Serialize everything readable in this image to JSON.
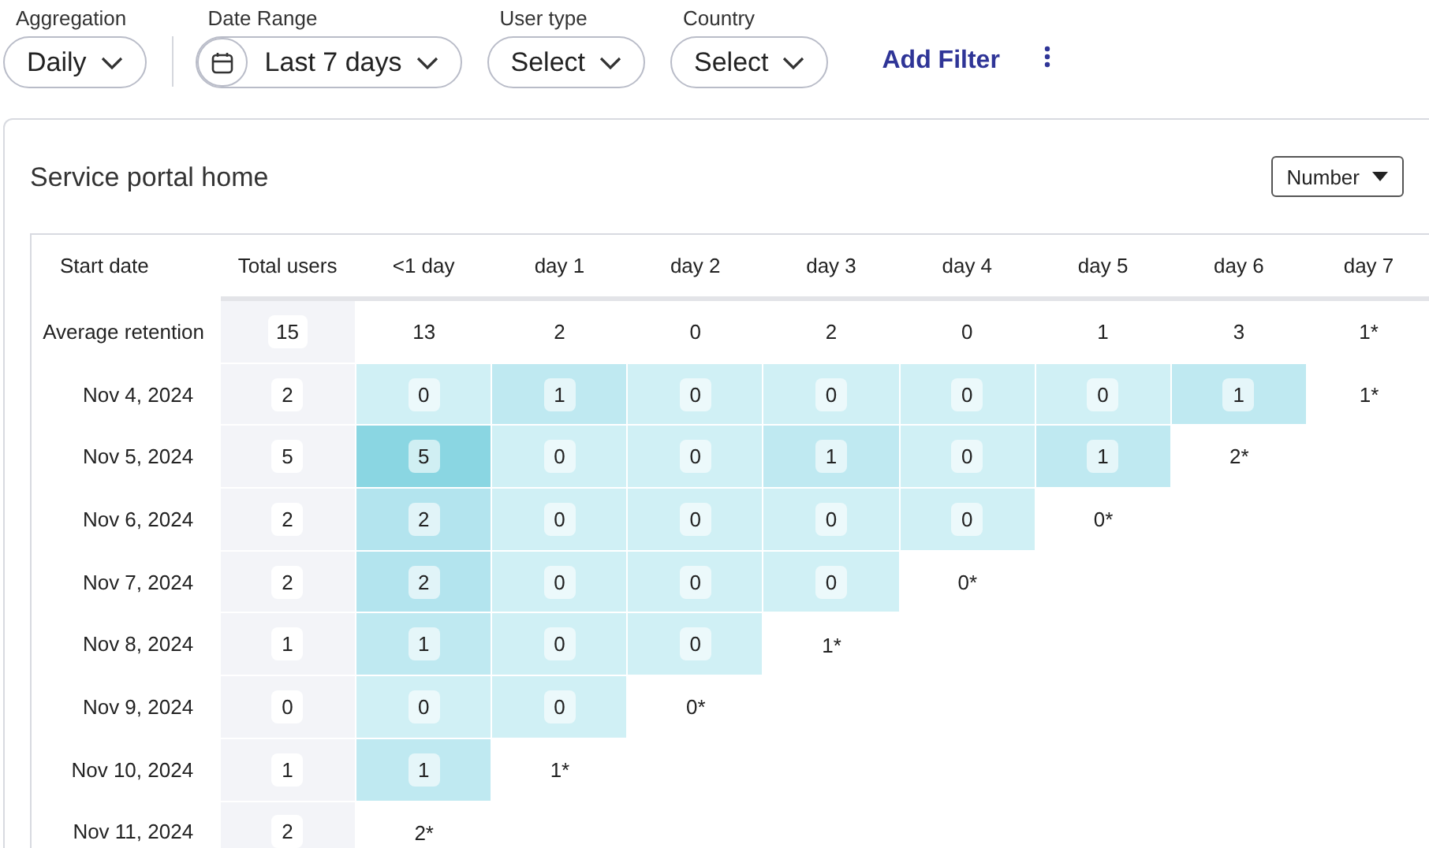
{
  "filters": [
    {
      "label": "Aggregation",
      "value": "Daily",
      "kind": "dropdown"
    },
    {
      "label": "Date Range",
      "value": "Last 7 days",
      "kind": "date_range"
    },
    {
      "label": "User type",
      "value": "Select",
      "kind": "dropdown"
    },
    {
      "label": "Country",
      "value": "Select",
      "kind": "dropdown"
    }
  ],
  "add_filter": "Add Filter",
  "card": {
    "title": "Service portal home",
    "metric_dropdown": "Number"
  },
  "table": {
    "columns": [
      "Start date",
      "Total users",
      "<1 day",
      "day 1",
      "day 2",
      "day 3",
      "day 4",
      "day 5",
      "day 6",
      "day 7"
    ],
    "rows": [
      [
        {
          "kind": "label",
          "value": "Average retention"
        },
        {
          "kind": "total",
          "value": "15"
        },
        {
          "kind": "plain",
          "value": "13"
        },
        {
          "kind": "plain",
          "value": "2"
        },
        {
          "kind": "plain",
          "value": "0"
        },
        {
          "kind": "plain",
          "value": "2"
        },
        {
          "kind": "plain",
          "value": "0"
        },
        {
          "kind": "plain",
          "value": "1"
        },
        {
          "kind": "plain",
          "value": "3"
        },
        {
          "kind": "plain",
          "value": "1*"
        }
      ],
      [
        {
          "kind": "label",
          "value": "Nov 4, 2024"
        },
        {
          "kind": "total",
          "value": "2"
        },
        {
          "kind": "heat",
          "value": "0",
          "color": "#d0f0f5"
        },
        {
          "kind": "heat",
          "value": "1",
          "color": "#bfe9f1"
        },
        {
          "kind": "heat",
          "value": "0",
          "color": "#d0f0f5"
        },
        {
          "kind": "heat",
          "value": "0",
          "color": "#d0f0f5"
        },
        {
          "kind": "heat",
          "value": "0",
          "color": "#d0f0f5"
        },
        {
          "kind": "heat",
          "value": "0",
          "color": "#d0f0f5"
        },
        {
          "kind": "heat",
          "value": "1",
          "color": "#bfe9f1"
        },
        {
          "kind": "plain",
          "value": "1*"
        }
      ],
      [
        {
          "kind": "label",
          "value": "Nov 5, 2024"
        },
        {
          "kind": "total",
          "value": "5"
        },
        {
          "kind": "heat",
          "value": "5",
          "color": "#8ad6e2"
        },
        {
          "kind": "heat",
          "value": "0",
          "color": "#d0f0f5"
        },
        {
          "kind": "heat",
          "value": "0",
          "color": "#d0f0f5"
        },
        {
          "kind": "heat",
          "value": "1",
          "color": "#bfe9f1"
        },
        {
          "kind": "heat",
          "value": "0",
          "color": "#d0f0f5"
        },
        {
          "kind": "heat",
          "value": "1",
          "color": "#bfe9f1"
        },
        {
          "kind": "plain",
          "value": "2*"
        }
      ],
      [
        {
          "kind": "label",
          "value": "Nov 6, 2024"
        },
        {
          "kind": "total",
          "value": "2"
        },
        {
          "kind": "heat",
          "value": "2",
          "color": "#b3e4ee"
        },
        {
          "kind": "heat",
          "value": "0",
          "color": "#d0f0f5"
        },
        {
          "kind": "heat",
          "value": "0",
          "color": "#d0f0f5"
        },
        {
          "kind": "heat",
          "value": "0",
          "color": "#d0f0f5"
        },
        {
          "kind": "heat",
          "value": "0",
          "color": "#d0f0f5"
        },
        {
          "kind": "plain",
          "value": "0*"
        }
      ],
      [
        {
          "kind": "label",
          "value": "Nov 7, 2024"
        },
        {
          "kind": "total",
          "value": "2"
        },
        {
          "kind": "heat",
          "value": "2",
          "color": "#b3e4ee"
        },
        {
          "kind": "heat",
          "value": "0",
          "color": "#d0f0f5"
        },
        {
          "kind": "heat",
          "value": "0",
          "color": "#d0f0f5"
        },
        {
          "kind": "heat",
          "value": "0",
          "color": "#d0f0f5"
        },
        {
          "kind": "plain",
          "value": "0*"
        }
      ],
      [
        {
          "kind": "label",
          "value": "Nov 8, 2024"
        },
        {
          "kind": "total",
          "value": "1"
        },
        {
          "kind": "heat",
          "value": "1",
          "color": "#bfe9f1"
        },
        {
          "kind": "heat",
          "value": "0",
          "color": "#d0f0f5"
        },
        {
          "kind": "heat",
          "value": "0",
          "color": "#d0f0f5"
        },
        {
          "kind": "plain",
          "value": "1*"
        }
      ],
      [
        {
          "kind": "label",
          "value": "Nov 9, 2024"
        },
        {
          "kind": "total",
          "value": "0"
        },
        {
          "kind": "heat",
          "value": "0",
          "color": "#d0f0f5"
        },
        {
          "kind": "heat",
          "value": "0",
          "color": "#d0f0f5"
        },
        {
          "kind": "plain",
          "value": "0*"
        }
      ],
      [
        {
          "kind": "label",
          "value": "Nov 10, 2024"
        },
        {
          "kind": "total",
          "value": "1"
        },
        {
          "kind": "heat",
          "value": "1",
          "color": "#bfe9f1"
        },
        {
          "kind": "plain",
          "value": "1*"
        }
      ],
      [
        {
          "kind": "label",
          "value": "Nov 11, 2024"
        },
        {
          "kind": "total",
          "value": "2"
        },
        {
          "kind": "plain",
          "value": "2*"
        }
      ]
    ]
  }
}
